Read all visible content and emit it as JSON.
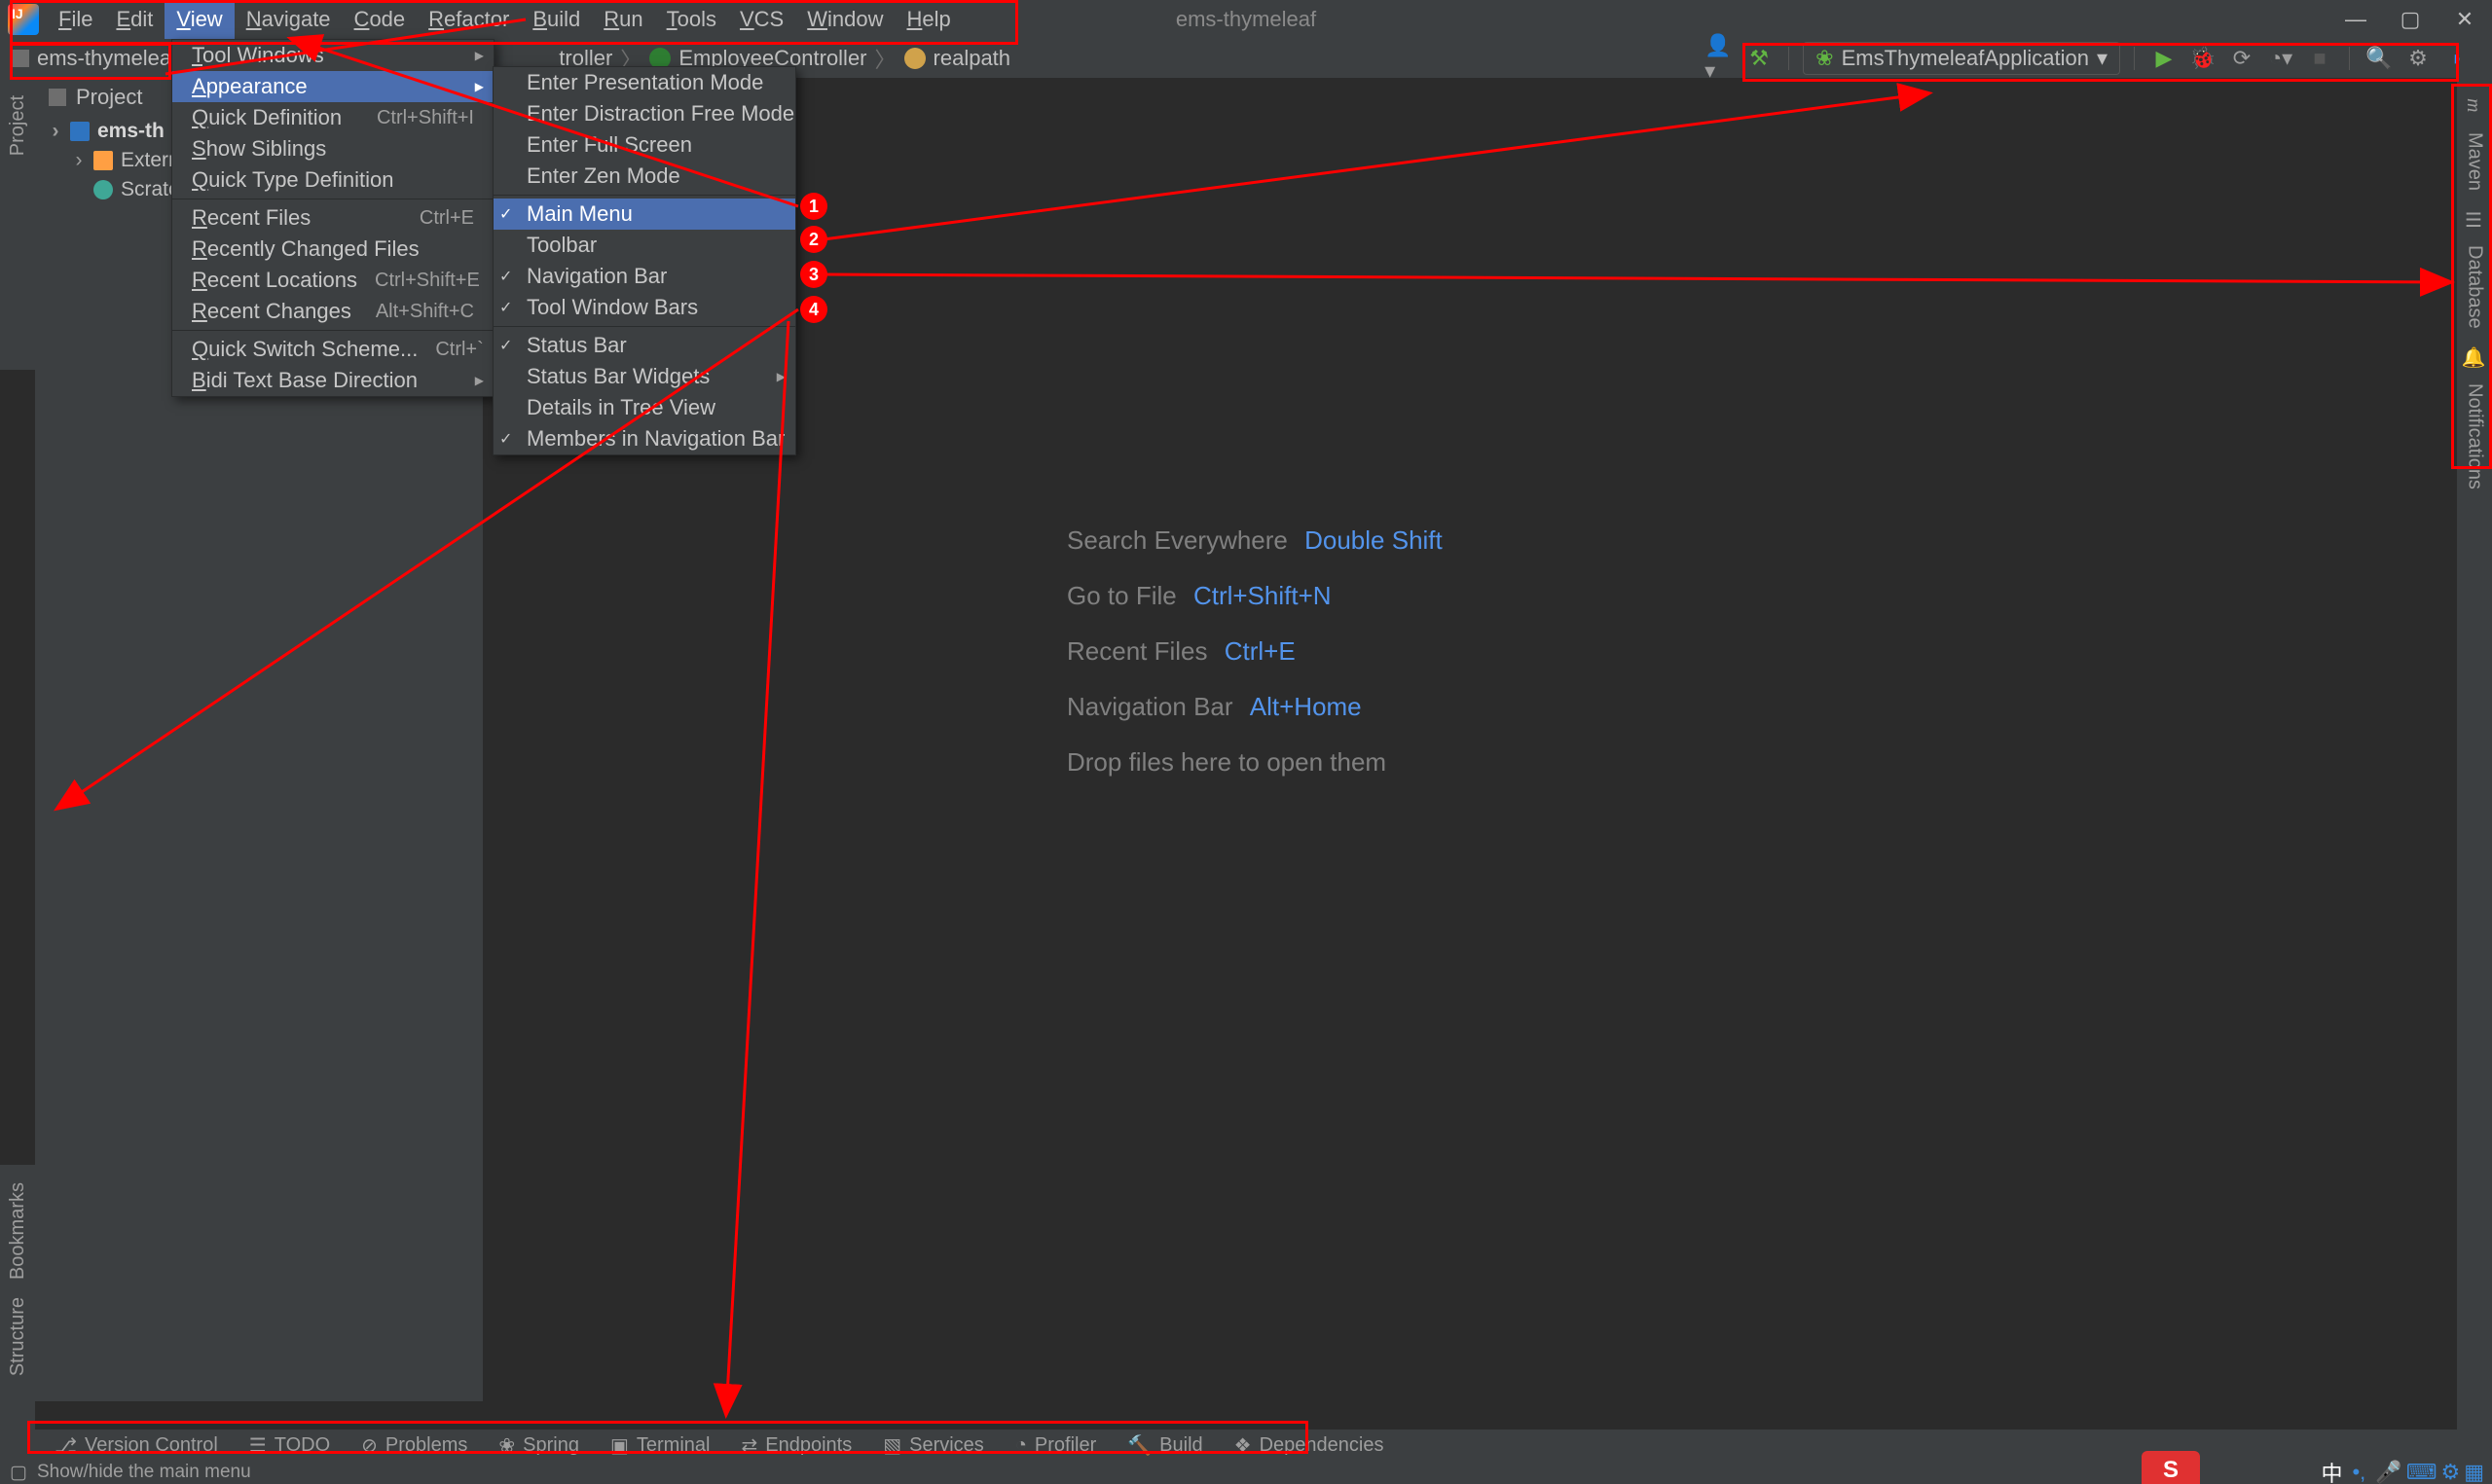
{
  "title": "ems-thymeleaf",
  "menubar": [
    "File",
    "Edit",
    "View",
    "Navigate",
    "Code",
    "Refactor",
    "Build",
    "Run",
    "Tools",
    "VCS",
    "Window",
    "Help"
  ],
  "menubar_selected_index": 2,
  "breadcrumb": {
    "b0": "ems-thymeleaf",
    "b1": "troller",
    "b2": "EmployeeController",
    "b3": "realpath"
  },
  "run_config": "EmsThymeleafApplication",
  "left_tools_top": [
    "Project"
  ],
  "left_tools_btm": [
    "Bookmarks",
    "Structure"
  ],
  "right_tools": [
    "Maven",
    "Database",
    "Notifications"
  ],
  "project": {
    "header": "Project",
    "root": "ems-th",
    "ext": "Externa",
    "scratch": "Scratch"
  },
  "view_menu": [
    {
      "t": "Tool Windows",
      "arrow": true
    },
    {
      "t": "Appearance",
      "arrow": true,
      "sel": true
    },
    {
      "t": "Quick Definition",
      "sc": "Ctrl+Shift+I"
    },
    {
      "t": "Show Siblings"
    },
    {
      "t": "Quick Type Definition"
    },
    {
      "sep": true
    },
    {
      "t": "Recent Files",
      "sc": "Ctrl+E"
    },
    {
      "t": "Recently Changed Files"
    },
    {
      "t": "Recent Locations",
      "sc": "Ctrl+Shift+E"
    },
    {
      "t": "Recent Changes",
      "sc": "Alt+Shift+C"
    },
    {
      "sep": true
    },
    {
      "t": "Quick Switch Scheme...",
      "sc": "Ctrl+`"
    },
    {
      "t": "Bidi Text Base Direction",
      "arrow": true
    }
  ],
  "appearance_menu": [
    {
      "t": "Enter Presentation Mode"
    },
    {
      "t": "Enter Distraction Free Mode"
    },
    {
      "t": "Enter Full Screen"
    },
    {
      "t": "Enter Zen Mode"
    },
    {
      "sep": true
    },
    {
      "t": "Main Menu",
      "chk": true,
      "sel": true
    },
    {
      "t": "Toolbar"
    },
    {
      "t": "Navigation Bar",
      "chk": true
    },
    {
      "t": "Tool Window Bars",
      "chk": true
    },
    {
      "sep": true
    },
    {
      "t": "Status Bar",
      "chk": true
    },
    {
      "t": "Status Bar Widgets",
      "arrow": true
    },
    {
      "t": "Details in Tree View"
    },
    {
      "t": "Members in Navigation Bar",
      "chk": true
    }
  ],
  "hints": [
    {
      "l": "Search Everywhere",
      "k": "Double Shift"
    },
    {
      "l": "Go to File",
      "k": "Ctrl+Shift+N"
    },
    {
      "l": "Recent Files",
      "k": "Ctrl+E"
    },
    {
      "l": "Navigation Bar",
      "k": "Alt+Home"
    },
    {
      "l": "Drop files here to open them",
      "k": ""
    }
  ],
  "bottom_tools": [
    "Version Control",
    "TODO",
    "Problems",
    "Spring",
    "Terminal",
    "Endpoints",
    "Services",
    "Profiler",
    "Build",
    "Dependencies"
  ],
  "bottom_icons": [
    "⎇",
    "☰",
    "⊘",
    "❀",
    "▣",
    "⇄",
    "▧",
    "◔",
    "🔨",
    "❖"
  ],
  "status_text": "Show/hide the main menu",
  "ime": "S",
  "ime_lang": "中"
}
